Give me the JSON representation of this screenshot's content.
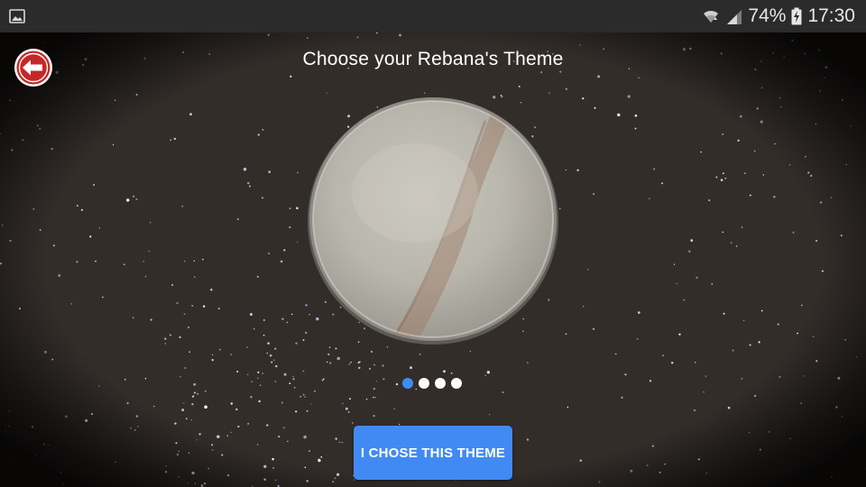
{
  "status_bar": {
    "notification_icon": "image-icon",
    "battery_percent": "74%",
    "time": "17:30",
    "icons": [
      "wifi-icon",
      "signal-icon",
      "battery-charging-icon"
    ]
  },
  "header": {
    "title": "Choose your Rebana's Theme",
    "back_icon": "back-arrow-icon",
    "back_color": "#c62828"
  },
  "carousel": {
    "page_count": 4,
    "active_index": 0,
    "active_color": "#3f8cf5",
    "inactive_color": "#ffffff"
  },
  "action": {
    "choose_label": "I CHOSE THIS THEME",
    "button_color": "#418af4"
  }
}
